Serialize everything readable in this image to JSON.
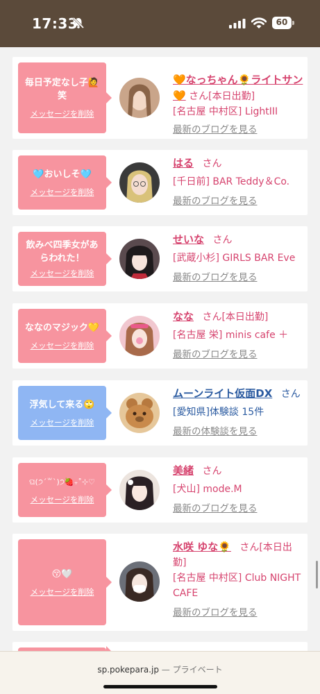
{
  "status": {
    "time": "17:33",
    "battery": "60"
  },
  "cards": [
    {
      "message": "毎日予定なし子🙋 笑",
      "delete": "メッセージを削除",
      "name": "🧡なっちゃん🌻ライトサン🧡",
      "san": "さん",
      "extra": "[本日出勤]",
      "shop": "[名古屋 中村区] LightIII",
      "blog": "最新のブログを見る"
    },
    {
      "message": "🩵おいしそ🩵",
      "delete": "メッセージを削除",
      "name": "はる",
      "san": "さん",
      "extra": "",
      "shop": "[千日前] BAR Teddy＆Co.",
      "blog": "最新のブログを見る"
    },
    {
      "message": "飲みべ四季女があらわれた！",
      "delete": "メッセージを削除",
      "name": "せいな",
      "san": "さん",
      "extra": "",
      "shop": "[武蔵小杉] GIRLS BAR Eve",
      "blog": "最新のブログを見る"
    },
    {
      "message": "ななのマジック💛",
      "delete": "メッセージを削除",
      "name": "なな",
      "san": "さん",
      "extra": "[本日出勤]",
      "shop": "[名古屋 栄] minis cafe ＋",
      "blog": "最新のブログを見る"
    },
    {
      "message": "浮気して来る🙄",
      "delete": "メッセージを削除",
      "name": "ムーンライト仮面DX",
      "san": "さん",
      "extra": "",
      "shop": "[愛知県]体験談 15件",
      "blog": "最新の体験談を見る"
    },
    {
      "message": "ଘ(੭ˊ꒳ˋ)੭🍓₊˚⊹♡",
      "delete": "メッセージを削除",
      "name": "美緒",
      "san": "さん",
      "extra": "",
      "shop": "[犬山] mode.M",
      "blog": "最新のブログを見る"
    },
    {
      "message": "😚🤍",
      "delete": "メッセージを削除",
      "name": "水咲 ゆな🌻",
      "san": "さん",
      "extra": "[本日出勤]",
      "shop": "[名古屋 中村区] Club NIGHT CAFE",
      "blog": "最新のブログを見る"
    }
  ],
  "browser": {
    "url": "sp.pokepara.jp",
    "separator": "—",
    "mode": "プライベート"
  },
  "colors": {
    "pink": "#f7949f",
    "blue": "#8fb6f3",
    "header": "#5b4a3a",
    "nameColor": "#d6436e"
  }
}
